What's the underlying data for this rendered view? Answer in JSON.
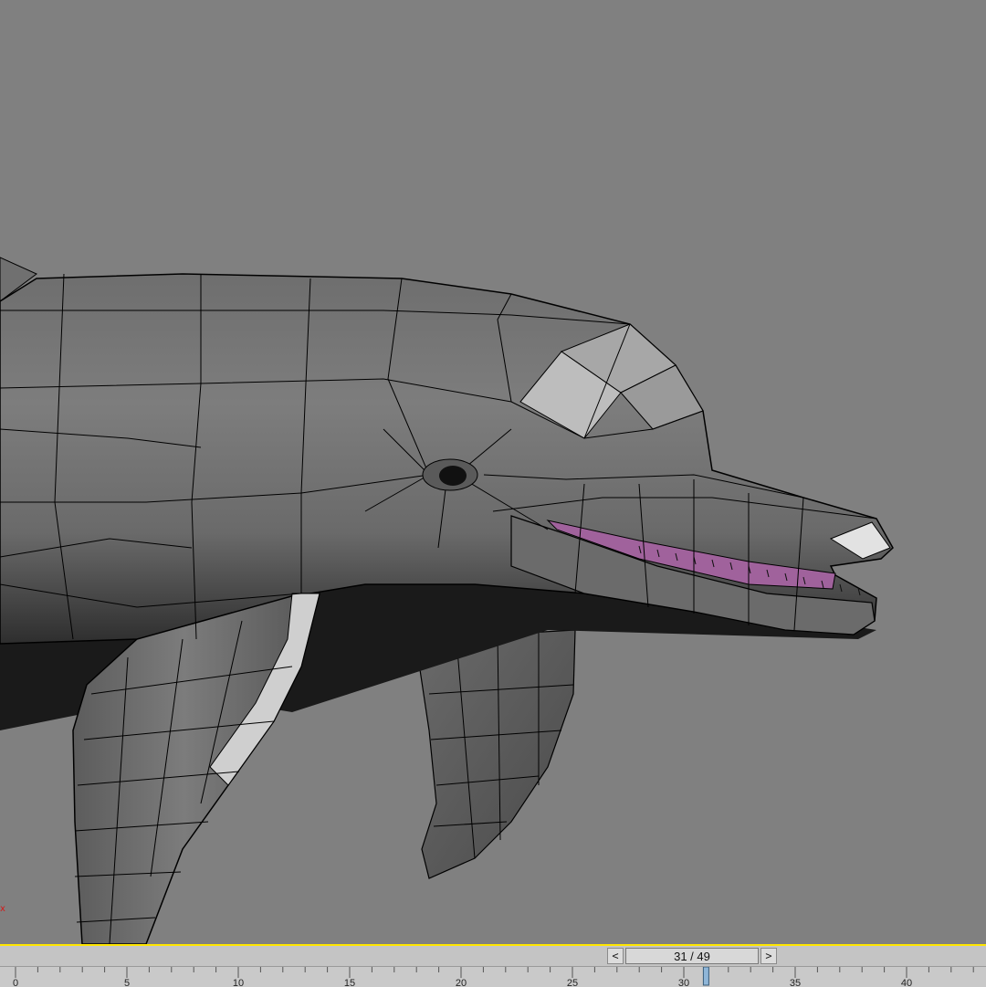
{
  "timeline": {
    "frame_readout": "31 / 49",
    "current_frame": 31,
    "total_frames": 49,
    "prev_label": "<",
    "next_label": ">",
    "ruler_labels": [
      "0",
      "5",
      "10",
      "15",
      "20",
      "25",
      "30",
      "35",
      "40"
    ]
  },
  "viewport": {
    "background_color": "#808080",
    "axis_marker": "x",
    "model": "dolphin-wireframe"
  },
  "colors": {
    "viewport_border": "#ffe600",
    "mouth_interior": "#a0629c",
    "mesh_lines": "#000000"
  }
}
